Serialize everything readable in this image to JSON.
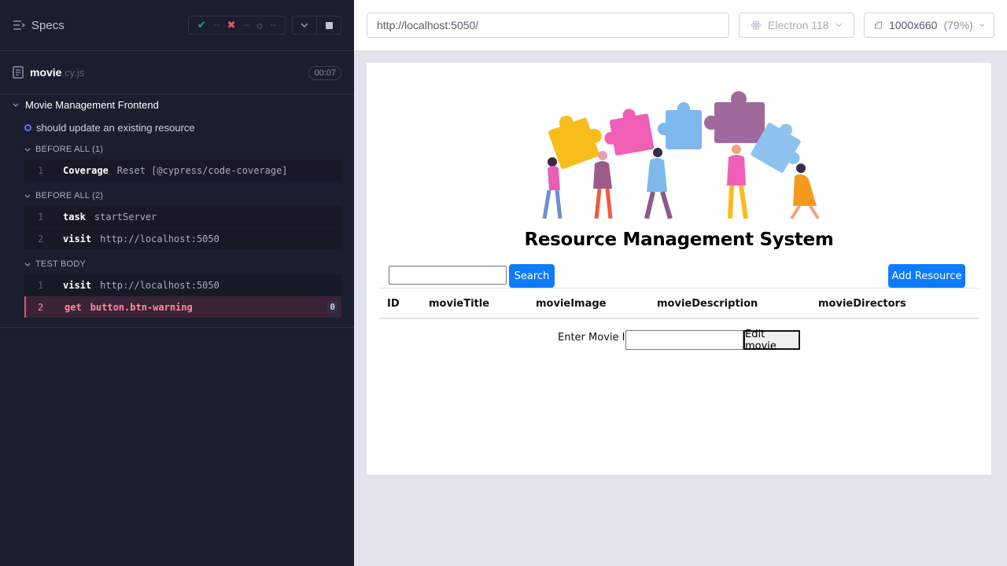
{
  "reporter": {
    "specs_label": "Specs",
    "stats": {
      "passed": "--",
      "failed": "--",
      "pending": "--"
    },
    "file": {
      "name": "movie",
      "ext": ".cy.js",
      "duration": "00:07"
    },
    "suite_title": "Movie Management Frontend",
    "test_title": "should update an existing resource",
    "hooks": [
      {
        "label": "BEFORE ALL (1)",
        "commands": [
          {
            "num": "1",
            "name": "Coverage",
            "message": "Reset [@cypress/code-coverage]"
          }
        ]
      },
      {
        "label": "BEFORE ALL (2)",
        "commands": [
          {
            "num": "1",
            "name": "task",
            "message": "startServer"
          },
          {
            "num": "2",
            "name": "visit",
            "message": "http://localhost:5050"
          }
        ]
      },
      {
        "label": "TEST BODY",
        "commands": [
          {
            "num": "1",
            "name": "visit",
            "message": "http://localhost:5050"
          },
          {
            "num": "2",
            "name": "get",
            "message": "button.btn-warning",
            "badge": "0"
          }
        ]
      }
    ]
  },
  "topbar": {
    "url": "http://localhost:5050/",
    "browser": "Electron 118",
    "viewport": "1000x660",
    "zoom": "(79%)"
  },
  "app": {
    "title": "Resource Management System",
    "search_button": "Search",
    "add_button": "Add Resource",
    "columns": [
      "ID",
      "movieTitle",
      "movieImage",
      "movieDescription",
      "movieDirectors"
    ],
    "edit_label": "Enter Movie ID:",
    "edit_button": "Edit movie"
  },
  "colors": {
    "reporter_bg": "#1b1e2e",
    "primary_button": "#0d7bfc",
    "failed_command": "#e45770",
    "passed": "#1fa971"
  }
}
